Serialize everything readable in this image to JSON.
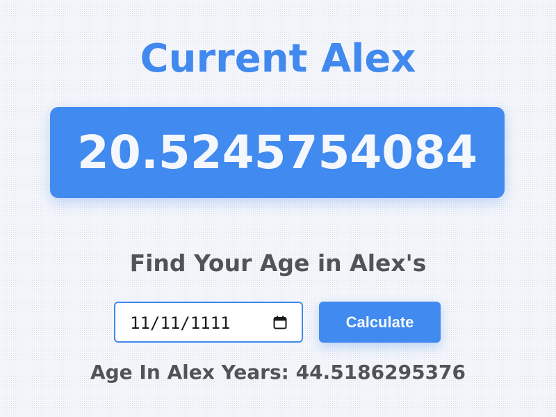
{
  "header": {
    "title": "Current Alex"
  },
  "current_value": {
    "value": "20.5245754084"
  },
  "calculator": {
    "heading": "Find Your Age in Alex's",
    "date_input_value": "11/11/1111",
    "calendar_icon": "calendar-icon",
    "button_label": "Calculate",
    "result_label": "Age In Alex Years:",
    "result_value": "44.5186295376"
  },
  "colors": {
    "accent": "#418aef",
    "text_dark": "#505358",
    "background": "#f4f6fb"
  }
}
